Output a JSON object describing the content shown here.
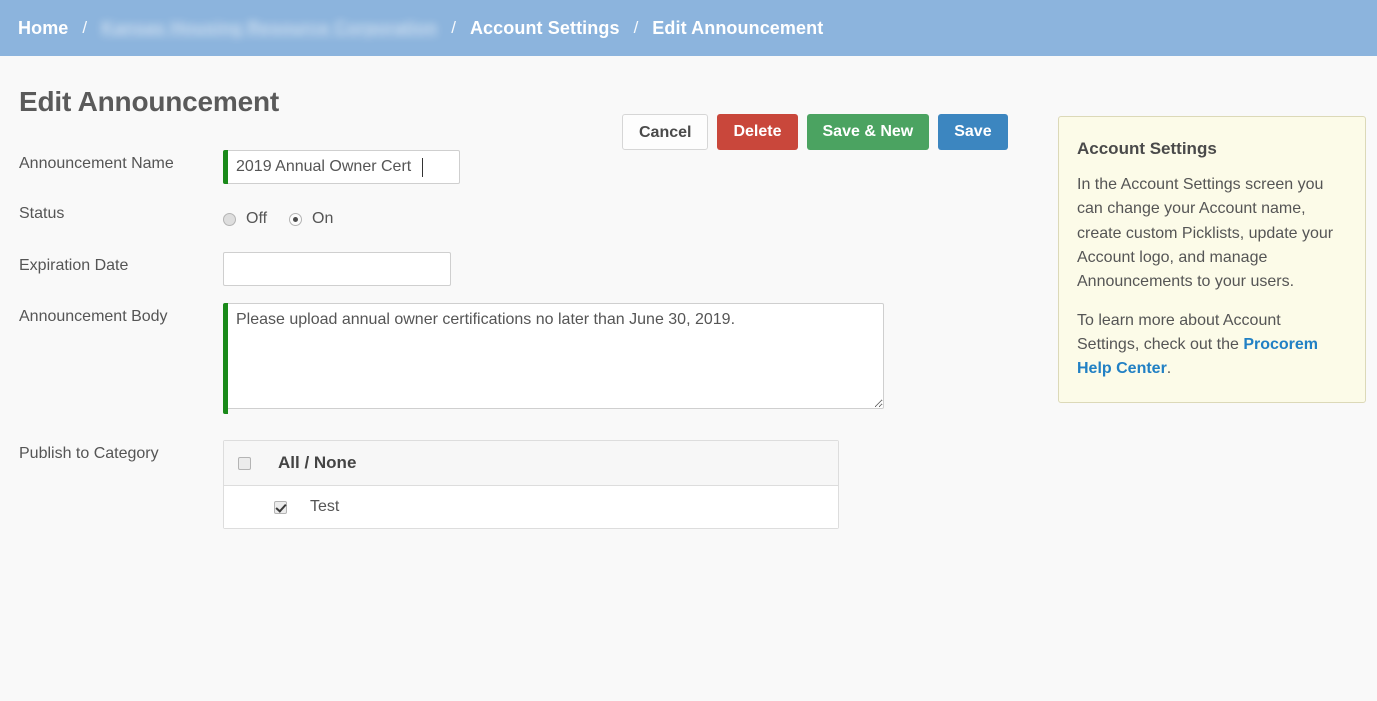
{
  "breadcrumb": {
    "items": [
      {
        "label": "Home",
        "redacted": false
      },
      {
        "label": "Kansas Housing Resource Corporation",
        "redacted": true
      },
      {
        "label": "Account Settings",
        "redacted": false
      },
      {
        "label": "Edit Announcement",
        "redacted": false
      }
    ],
    "separator": "/"
  },
  "page": {
    "title": "Edit Announcement"
  },
  "toolbar": {
    "cancel_label": "Cancel",
    "delete_label": "Delete",
    "save_new_label": "Save & New",
    "save_label": "Save"
  },
  "form": {
    "name": {
      "label": "Announcement Name",
      "value": "2019 Annual Owner Cert",
      "placeholder": ""
    },
    "status": {
      "label": "Status",
      "options": [
        {
          "label": "Off",
          "selected": false
        },
        {
          "label": "On",
          "selected": true
        }
      ]
    },
    "expiration": {
      "label": "Expiration Date",
      "value": "",
      "placeholder": ""
    },
    "body": {
      "label": "Announcement Body",
      "value": "Please upload annual owner certifications no later than June 30, 2019.",
      "placeholder": ""
    },
    "categories": {
      "label": "Publish to Category",
      "header_label": "All / None",
      "header_checked": false,
      "rows": [
        {
          "label": "Test",
          "checked": true
        }
      ]
    }
  },
  "help_panel": {
    "title": "Account Settings",
    "paragraph1": "In the Account Settings screen you can change your Account name, create custom Picklists, update your Account logo, and manage Announcements to your users.",
    "paragraph2_before": "To learn more about Account Settings, check out the ",
    "link_label": "Procorem Help Center",
    "paragraph2_after": "."
  },
  "colors": {
    "header_blue": "#8cb4dd",
    "delete_red": "#c9473b",
    "save_new_green": "#4ba361",
    "save_blue": "#3c86c0",
    "required_green": "#1a8a1a",
    "help_bg": "#fcfbe8",
    "help_border": "#dcd9b8",
    "link_blue": "#2180c4",
    "page_bg": "#f9f9f9"
  }
}
